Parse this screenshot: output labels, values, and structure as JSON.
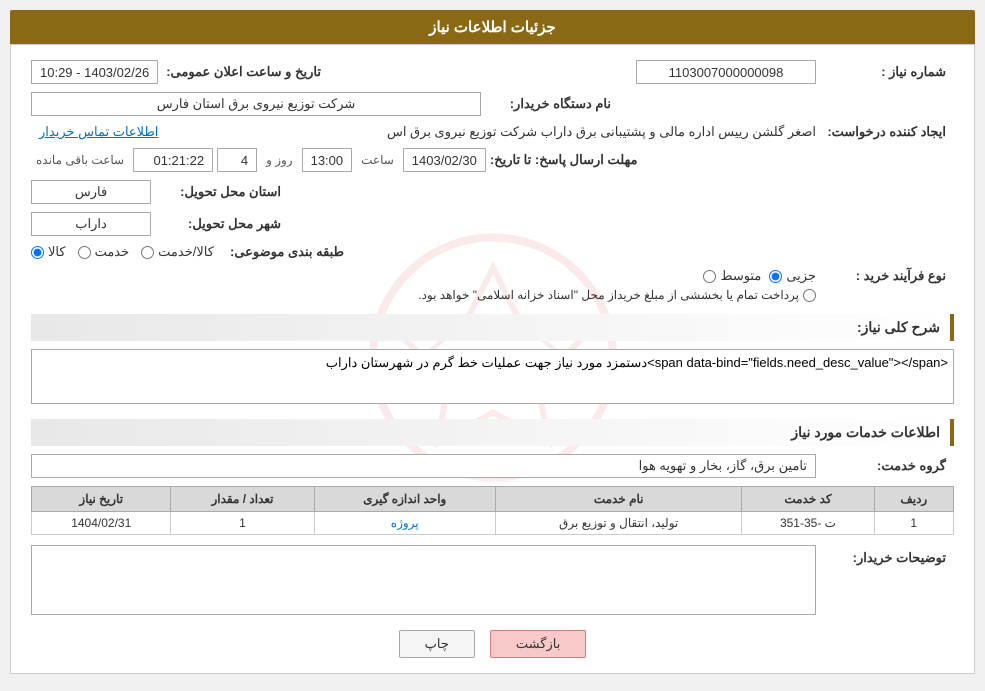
{
  "header": {
    "title": "جزئیات اطلاعات نیاز"
  },
  "fields": {
    "need_number_label": "شماره نیاز :",
    "need_number_value": "1103007000000098",
    "buyer_org_label": "نام دستگاه خریدار:",
    "buyer_org_value": "شرکت توزیع نیروی برق استان فارس",
    "creator_label": "ایجاد کننده درخواست:",
    "creator_value": "اصغر گلشن رییس اداره مالی و پشتیبانی برق داراب شرکت توزیع نیروی برق اس",
    "contact_link": "اطلاعات تماس خریدار",
    "deadline_label": "مهلت ارسال پاسخ: تا تاریخ:",
    "deadline_date": "1403/02/30",
    "deadline_time_label": "ساعت",
    "deadline_time": "13:00",
    "deadline_days_label": "روز و",
    "deadline_days": "4",
    "remaining_label": "ساعت باقی مانده",
    "remaining_time": "01:21:22",
    "announce_label": "تاریخ و ساعت اعلان عمومی:",
    "announce_value": "1403/02/26 - 10:29",
    "province_label": "استان محل تحویل:",
    "province_value": "فارس",
    "city_label": "شهر محل تحویل:",
    "city_value": "داراب",
    "category_label": "طبقه بندی موضوعی:",
    "category_options": [
      "کالا",
      "خدمت",
      "کالا/خدمت"
    ],
    "category_selected": "کالا",
    "purchase_type_label": "نوع فرآیند خرید :",
    "purchase_options": [
      "جزیی",
      "متوسط",
      "پرداخت تمام یا بخششی از مبلغ خریداز محل \"اسناد خزانه اسلامی\" خواهد بود."
    ],
    "purchase_selected": "جزیی",
    "need_desc_title": "شرح کلی نیاز:",
    "need_desc_value": "دستمزد مورد نیاز جهت عملیات خط گرم در شهرستان داراب",
    "services_title": "اطلاعات خدمات مورد نیاز",
    "service_group_label": "گروه خدمت:",
    "service_group_value": "تامین برق، گاز، بخار و تهویه هوا",
    "table": {
      "columns": [
        "ردیف",
        "کد خدمت",
        "نام خدمت",
        "واحد اندازه گیری",
        "تعداد / مقدار",
        "تاریخ نیاز"
      ],
      "rows": [
        {
          "row": "1",
          "code": "ت -35-351",
          "name": "تولید، انتقال و توزیع برق",
          "unit": "پروژه",
          "quantity": "1",
          "date": "1404/02/31"
        }
      ]
    },
    "buyer_notes_label": "توضیحات خریدار:",
    "buyer_notes_value": ""
  },
  "buttons": {
    "back": "بازگشت",
    "print": "چاپ"
  }
}
